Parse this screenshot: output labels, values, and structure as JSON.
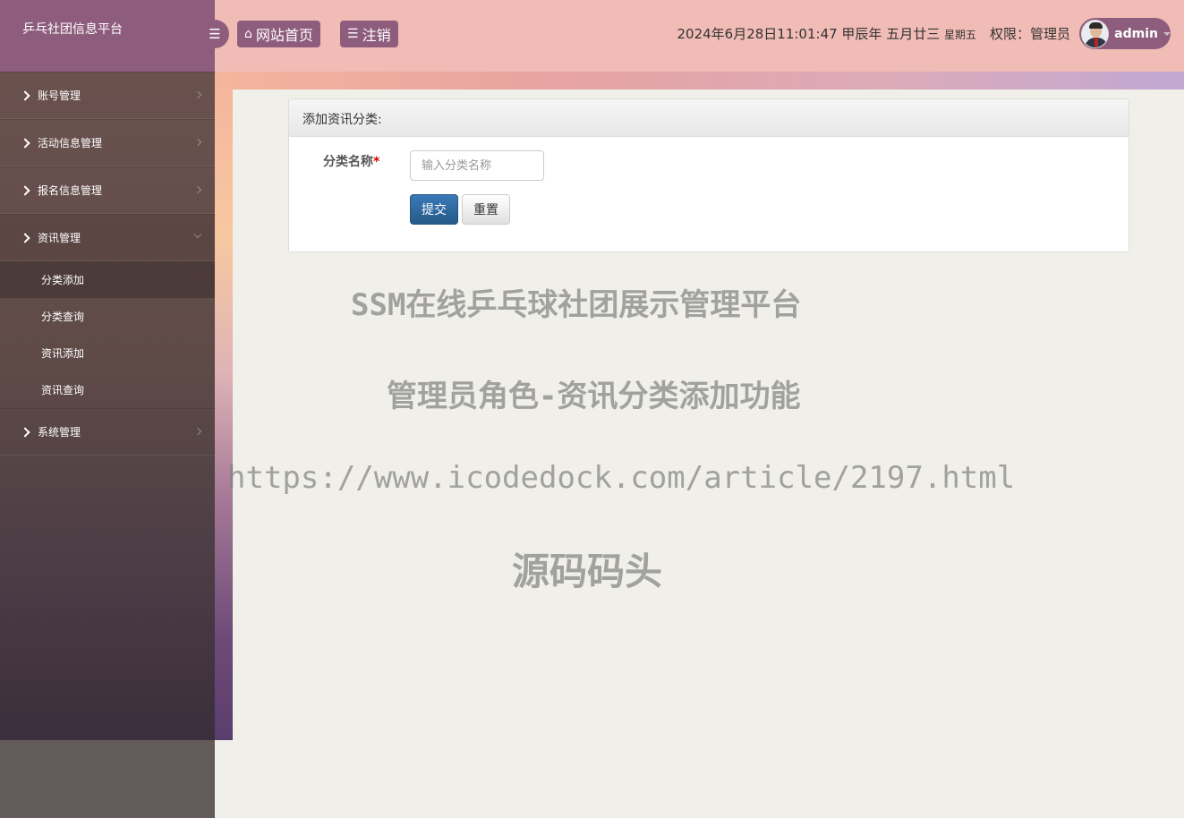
{
  "brand": {
    "title": "乒乓社团信息平台"
  },
  "sidebar": {
    "items": [
      {
        "label": "账号管理"
      },
      {
        "label": "活动信息管理"
      },
      {
        "label": "报名信息管理"
      },
      {
        "label": "资讯管理",
        "open": true,
        "children": [
          {
            "label": "分类添加",
            "active": true
          },
          {
            "label": "分类查询"
          },
          {
            "label": "资讯添加"
          },
          {
            "label": "资讯查询"
          }
        ]
      },
      {
        "label": "系统管理"
      }
    ]
  },
  "topbar": {
    "menu_icon": "bars-icon",
    "home_label": "网站首页",
    "home_icon": "home-icon",
    "logout_label": "注销",
    "logout_icon": "list-icon",
    "datetime": "2024年6月28日11:01:47 甲辰年 五月廿三",
    "weekday": "星期五",
    "permission": "权限：管理员",
    "user": "admin"
  },
  "form": {
    "heading": "添加资讯分类:",
    "field_label": "分类名称",
    "required_mark": "*",
    "placeholder": "输入分类名称",
    "submit_label": "提交",
    "reset_label": "重置"
  },
  "watermark": {
    "line1": "SSM在线乒乓球社团展示管理平台",
    "line2": "管理员角色-资讯分类添加功能",
    "line3": "https://www.icodedock.com/article/2197.html",
    "line4": "源码码头"
  },
  "colors": {
    "accent": "#8e5d7d",
    "topbar": "#f1bcb6",
    "primary_button": "#2e6da4"
  }
}
